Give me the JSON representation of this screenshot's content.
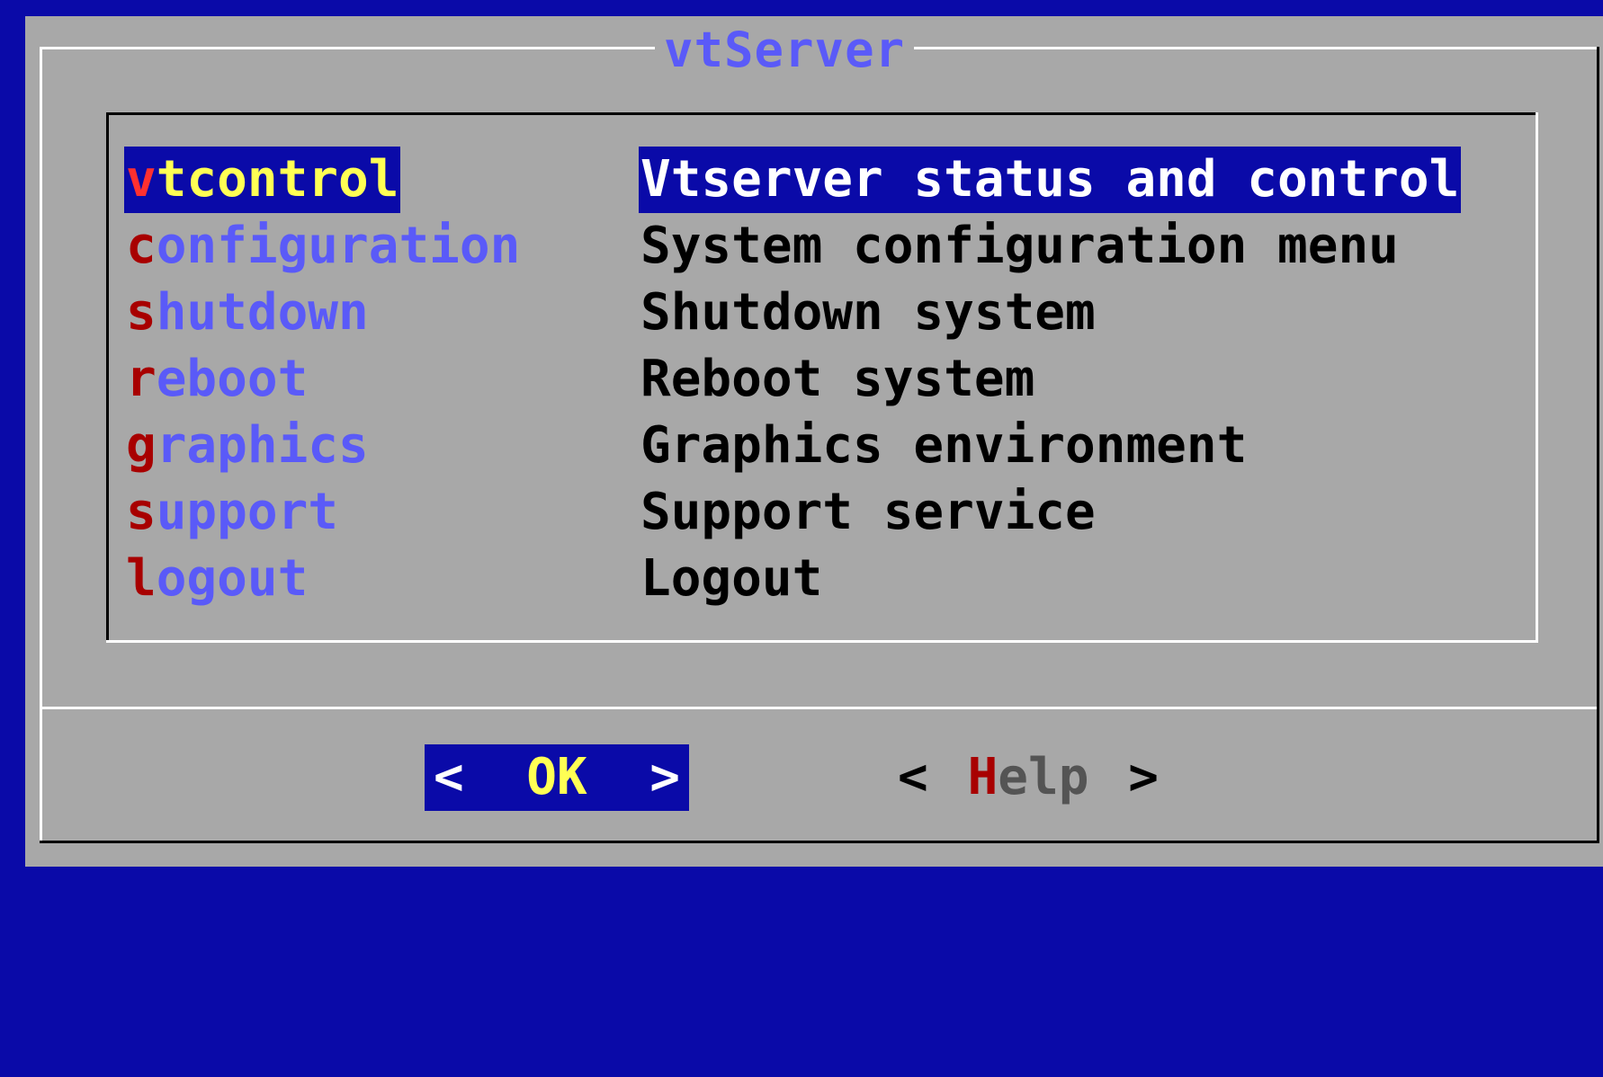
{
  "dialog": {
    "title": "vtServer"
  },
  "menu": {
    "selected_index": 0,
    "items": [
      {
        "hotkey": "v",
        "rest": "tcontrol",
        "description": "Vtserver status and control"
      },
      {
        "hotkey": "c",
        "rest": "onfiguration",
        "description": "System configuration menu"
      },
      {
        "hotkey": "s",
        "rest": "hutdown",
        "description": "Shutdown system"
      },
      {
        "hotkey": "r",
        "rest": "eboot",
        "description": "Reboot system"
      },
      {
        "hotkey": "g",
        "rest": "raphics",
        "description": "Graphics environment"
      },
      {
        "hotkey": "s",
        "rest": "upport",
        "description": "Support service"
      },
      {
        "hotkey": "l",
        "rest": "ogout",
        "description": "Logout"
      }
    ]
  },
  "buttons": {
    "ok": {
      "left": "<",
      "label": "OK",
      "right": ">"
    },
    "help": {
      "left": "<",
      "hotkey": "H",
      "rest": "elp",
      "right": ">"
    }
  },
  "colors": {
    "screen_background": "#0a0aa8",
    "dialog_background": "#a8a8a8",
    "tag_text": "#5a5af8",
    "hotkey": "#a80000",
    "selection_background": "#0a0aa8",
    "selection_tag_text": "#ffff54"
  }
}
